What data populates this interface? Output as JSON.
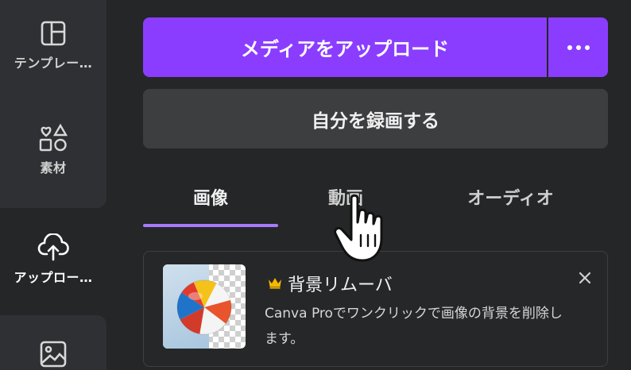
{
  "sidebar": {
    "items": [
      {
        "label": "テンプレー…",
        "icon": "template-layout-icon"
      },
      {
        "label": "素材",
        "icon": "elements-shapes-icon"
      },
      {
        "label": "アップロー…",
        "icon": "cloud-upload-icon",
        "active": true
      },
      {
        "label": "",
        "icon": "photos-image-icon"
      }
    ]
  },
  "actions": {
    "upload_label": "メディアをアップロード",
    "more_icon": "more-dots-icon",
    "record_label": "自分を録画する"
  },
  "tabs": [
    {
      "label": "画像",
      "selected": true
    },
    {
      "label": "動画",
      "selected": false
    },
    {
      "label": "オーディオ",
      "selected": false
    }
  ],
  "promo": {
    "title": "背景リムーバ",
    "description": "Canva Proでワンクリックで画像の背景を削除します。",
    "badge_icon": "crown-icon",
    "close_icon": "close-icon",
    "thumbnail": "beach-ball-image"
  },
  "colors": {
    "accent": "#8b3dff",
    "tab_underline": "#a57bff",
    "crown": "#f5b800",
    "panel_bg": "#252627",
    "rail_bg": "#2f3033"
  }
}
